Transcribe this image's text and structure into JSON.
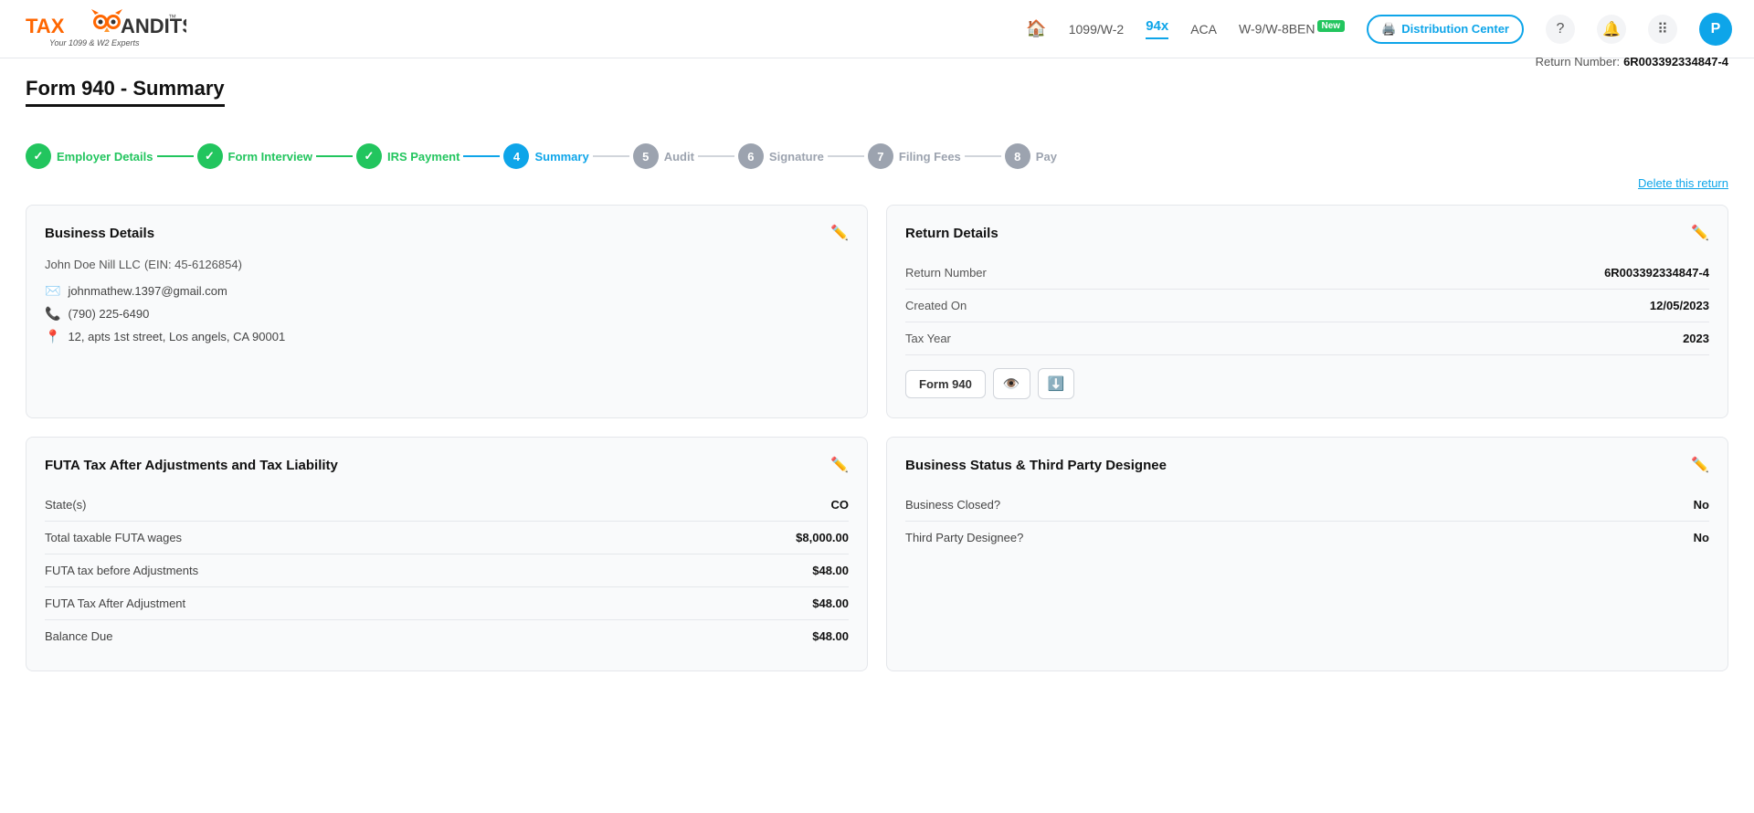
{
  "nav": {
    "home_icon": "🏠",
    "links": [
      {
        "label": "1099/W-2",
        "active": false
      },
      {
        "label": "94x",
        "active": true
      },
      {
        "label": "ACA",
        "active": false
      },
      {
        "label": "W-9/W-8BEN",
        "active": false,
        "new_badge": true
      }
    ],
    "dist_center_label": "Distribution Center",
    "avatar_letter": "P"
  },
  "page": {
    "title": "Form 940 - Summary",
    "return_number_label": "Return Number:",
    "return_number": "6R003392334847-4"
  },
  "stepper": {
    "steps": [
      {
        "number": "✓",
        "label": "Employer Details",
        "state": "done"
      },
      {
        "number": "✓",
        "label": "Form Interview",
        "state": "done"
      },
      {
        "number": "✓",
        "label": "IRS Payment",
        "state": "done"
      },
      {
        "number": "4",
        "label": "Summary",
        "state": "active"
      },
      {
        "number": "5",
        "label": "Audit",
        "state": "pending"
      },
      {
        "number": "6",
        "label": "Signature",
        "state": "pending"
      },
      {
        "number": "7",
        "label": "Filing Fees",
        "state": "pending"
      },
      {
        "number": "8",
        "label": "Pay",
        "state": "pending"
      }
    ],
    "delete_label": "Delete this return"
  },
  "business_details": {
    "card_title": "Business Details",
    "company_name": "John Doe Nill LLC",
    "ein_label": "(EIN: 45-6126854)",
    "email": "johnmathew.1397@gmail.com",
    "phone": "(790) 225-6490",
    "address": "12, apts 1st street, Los angels, CA 90001"
  },
  "return_details": {
    "card_title": "Return Details",
    "rows": [
      {
        "label": "Return Number",
        "value": "6R003392334847-4"
      },
      {
        "label": "Created On",
        "value": "12/05/2023"
      },
      {
        "label": "Tax Year",
        "value": "2023"
      }
    ],
    "form_btn_label": "Form 940"
  },
  "futa": {
    "card_title": "FUTA Tax After Adjustments and Tax Liability",
    "rows": [
      {
        "label": "State(s)",
        "value": "CO"
      },
      {
        "label": "Total taxable FUTA wages",
        "value": "$8,000.00"
      },
      {
        "label": "FUTA tax before Adjustments",
        "value": "$48.00"
      },
      {
        "label": "FUTA Tax After Adjustment",
        "value": "$48.00"
      },
      {
        "label": "Balance Due",
        "value": "$48.00"
      }
    ]
  },
  "business_status": {
    "card_title": "Business Status & Third Party Designee",
    "rows": [
      {
        "label": "Business Closed?",
        "value": "No"
      },
      {
        "label": "Third Party Designee?",
        "value": "No"
      }
    ]
  }
}
